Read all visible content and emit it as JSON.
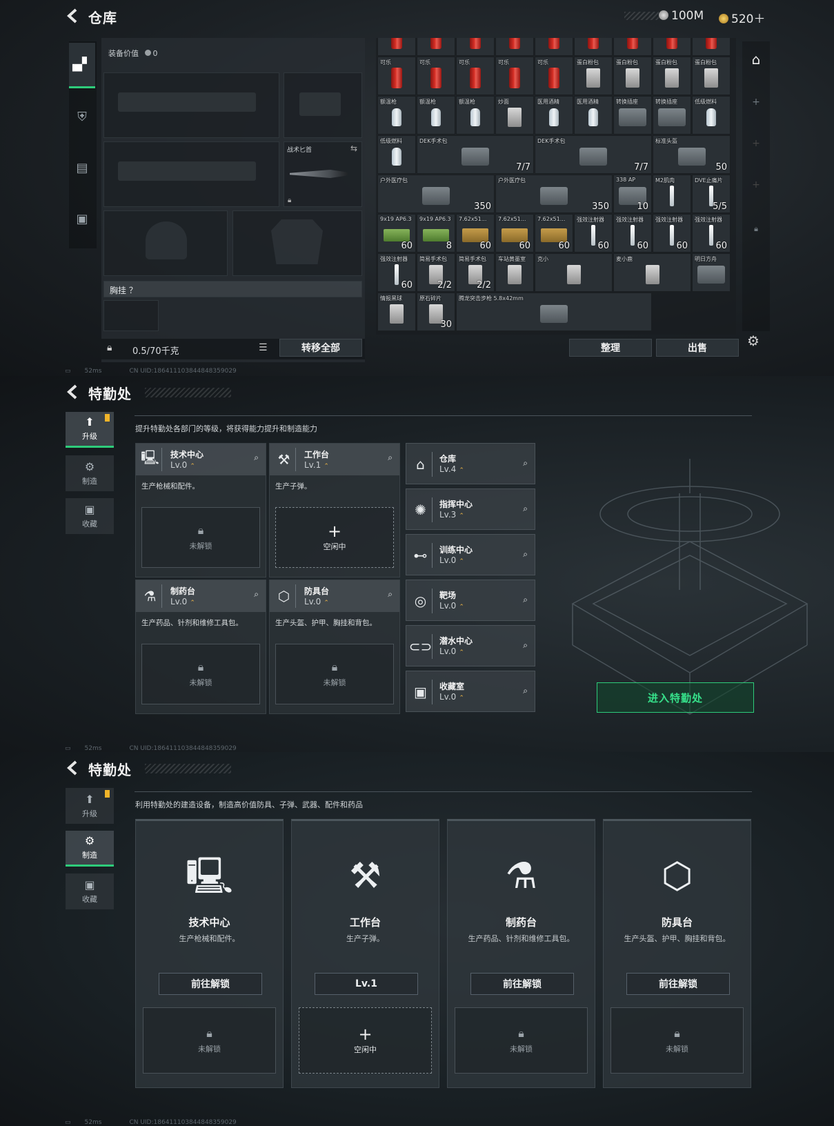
{
  "screen1": {
    "title": "仓库",
    "currency": [
      {
        "icon": "silver-coin-icon",
        "value": "100M"
      },
      {
        "icon": "gold-coin-icon",
        "value": "520＋"
      }
    ],
    "tabs": [
      {
        "icon": "pistol-icon",
        "active": true
      },
      {
        "icon": "armor-icon",
        "active": false
      },
      {
        "icon": "clipboard-icon",
        "active": false
      },
      {
        "icon": "briefcase-icon",
        "active": false
      }
    ],
    "equip_value_label": "装备价值",
    "equip_value": "0",
    "knife_label": "战术匕首",
    "chest_rig_label": "胸挂 ？",
    "weight": "0.5/70千克",
    "transfer_all": "转移全部",
    "sort": "整理",
    "sell": "出售",
    "storage": {
      "rows": [
        [
          {
            "n": "",
            "c": ""
          },
          {
            "n": "",
            "c": ""
          },
          {
            "n": "",
            "c": ""
          },
          {
            "n": "",
            "c": ""
          },
          {
            "n": "",
            "c": ""
          },
          {
            "n": "",
            "c": ""
          },
          {
            "n": "",
            "c": ""
          },
          {
            "n": "",
            "c": ""
          },
          {
            "n": "",
            "c": ""
          }
        ],
        [
          {
            "n": "可乐",
            "c": "",
            "k": "can"
          },
          {
            "n": "可乐",
            "c": "",
            "k": "can"
          },
          {
            "n": "可乐",
            "c": "",
            "k": "can"
          },
          {
            "n": "可乐",
            "c": "",
            "k": "can"
          },
          {
            "n": "可乐",
            "c": "",
            "k": "can"
          },
          {
            "n": "蛋白粉包",
            "c": "",
            "k": "wrap"
          },
          {
            "n": "蛋白粉包",
            "c": "",
            "k": "wrap"
          },
          {
            "n": "蛋白粉包",
            "c": "",
            "k": "wrap"
          },
          {
            "n": "蛋白粉包",
            "c": "",
            "k": "wrap"
          }
        ],
        [
          {
            "n": "额温枪",
            "c": "",
            "k": "bottle"
          },
          {
            "n": "额温枪",
            "c": "",
            "k": "bottle"
          },
          {
            "n": "额温枪",
            "c": "",
            "k": "bottle"
          },
          {
            "n": "炒面",
            "c": "",
            "k": "wrap"
          },
          {
            "n": "医用酒精",
            "c": "",
            "k": "bottle"
          },
          {
            "n": "医用酒精",
            "c": "",
            "k": "bottle"
          },
          {
            "n": "转换插座",
            "c": "",
            "k": "box"
          },
          {
            "n": "转换插座",
            "c": "",
            "k": "box"
          },
          {
            "n": "低级燃料",
            "c": "",
            "k": "bottle"
          }
        ]
      ],
      "row4": [
        {
          "n": "低级燃料",
          "c": ""
        },
        {
          "n": "DEK手术包",
          "c": "7/7"
        },
        {
          "n": "DEK手术包",
          "c": "7/7"
        },
        {
          "n": "标准头盔",
          "c": "50"
        }
      ],
      "row5": [
        {
          "n": "户外医疗包",
          "c": "350"
        },
        {
          "n": "户外医疗包",
          "c": "350"
        },
        {
          "n": "338 AP",
          "c": "10"
        },
        {
          "n": "M2肌肉",
          "c": ""
        },
        {
          "n": "DVE止痛片",
          "c": "5/5"
        }
      ],
      "row6": [
        {
          "n": "9x19 AP6.3",
          "c": "60"
        },
        {
          "n": "9x19 AP6.3",
          "c": "8"
        },
        {
          "n": "7.62x51...",
          "c": "60"
        },
        {
          "n": "7.62x51...",
          "c": "60"
        },
        {
          "n": "7.62x51...",
          "c": "60"
        },
        {
          "n": "强效注射器",
          "c": "60"
        },
        {
          "n": "强效注射器",
          "c": "60"
        },
        {
          "n": "强效注射器",
          "c": "60"
        },
        {
          "n": "强效注射器",
          "c": "60"
        }
      ],
      "row7": [
        {
          "n": "强效注射器",
          "c": "60"
        },
        {
          "n": "简易手术包",
          "c": "2/2"
        },
        {
          "n": "简易手术包",
          "c": "2/2"
        },
        {
          "n": "车站黄墨室",
          "c": ""
        },
        {
          "n": "克小",
          "c": ""
        },
        {
          "n": "麦小鹿",
          "c": ""
        },
        {
          "n": "明日方舟",
          "c": ""
        }
      ],
      "row8": [
        {
          "n": "情报黑球",
          "c": ""
        },
        {
          "n": "原石碎片",
          "c": "30"
        },
        {
          "n": "腾龙突击步枪 5.8x42mm",
          "c": ""
        }
      ]
    },
    "status": {
      "ping": "52ms",
      "uid": "CN UID:1864111038448483590​29"
    }
  },
  "screen2": {
    "title": "特勤处",
    "nav": [
      {
        "label": "升级",
        "icon": "upgrade-icon",
        "active": true
      },
      {
        "label": "制造",
        "icon": "gears-icon",
        "active": false
      },
      {
        "label": "收藏",
        "icon": "collection-icon",
        "active": false
      }
    ],
    "description": "提升特勤处各部门的等级，将获得能力提升和制造能力",
    "facilities": [
      {
        "name": "技术中心",
        "level": "Lv.0",
        "desc": "生产枪械和配件。",
        "slot": "未解锁",
        "icon": "tech-center-icon"
      },
      {
        "name": "工作台",
        "level": "Lv.1",
        "desc": "生产子弹。",
        "slot": "空闲中",
        "icon": "workbench-icon"
      },
      {
        "name": "制药台",
        "level": "Lv.0",
        "desc": "生产药品、针剂和维修工具包。",
        "slot": "未解锁",
        "icon": "pharmacy-icon"
      },
      {
        "name": "防具台",
        "level": "Lv.0",
        "desc": "生产头盔、护甲、胸挂和背包。",
        "slot": "未解锁",
        "icon": "armor-bench-icon"
      }
    ],
    "side_facilities": [
      {
        "name": "仓库",
        "level": "Lv.4",
        "icon": "warehouse-icon"
      },
      {
        "name": "指挥中心",
        "level": "Lv.3",
        "icon": "command-center-icon"
      },
      {
        "name": "训练中心",
        "level": "Lv.0",
        "icon": "training-icon"
      },
      {
        "name": "靶场",
        "level": "Lv.0",
        "icon": "target-icon"
      },
      {
        "name": "潜水中心",
        "level": "Lv.0",
        "icon": "diving-icon"
      },
      {
        "name": "收藏室",
        "level": "Lv.0",
        "icon": "collection-room-icon"
      }
    ],
    "enter_button": "进入特勤处",
    "status": {
      "ping": "52ms",
      "uid": "CN UID:1864111038448483590​29"
    }
  },
  "screen3": {
    "title": "特勤处",
    "nav": [
      {
        "label": "升级",
        "icon": "upgrade-icon",
        "active": false
      },
      {
        "label": "制造",
        "icon": "gears-icon",
        "active": true
      },
      {
        "label": "收藏",
        "icon": "collection-icon",
        "active": false
      }
    ],
    "description": "利用特勤处的建造设备，制造高价值防具、子弹、武器、配件和药品",
    "cards": [
      {
        "name": "技术中心",
        "desc": "生产枪械和配件。",
        "button": "前往解锁",
        "slot": "未解锁",
        "icon": "tech-center-icon"
      },
      {
        "name": "工作台",
        "desc": "生产子弹。",
        "button": "Lv.1",
        "slot": "空闲中",
        "icon": "workbench-icon"
      },
      {
        "name": "制药台",
        "desc": "生产药品、针剂和维修工具包。",
        "button": "前往解锁",
        "slot": "未解锁",
        "icon": "pharmacy-icon"
      },
      {
        "name": "防具台",
        "desc": "生产头盔、护甲、胸挂和背包。",
        "button": "前往解锁",
        "slot": "未解锁",
        "icon": "armor-bench-icon"
      }
    ],
    "status": {
      "ping": "52ms",
      "uid": "CN UID:1864111038448483590​29"
    }
  },
  "colors": {
    "accent_green": "#2ecc7a",
    "badge_yellow": "#f0b429",
    "panel": "#2e3439"
  }
}
